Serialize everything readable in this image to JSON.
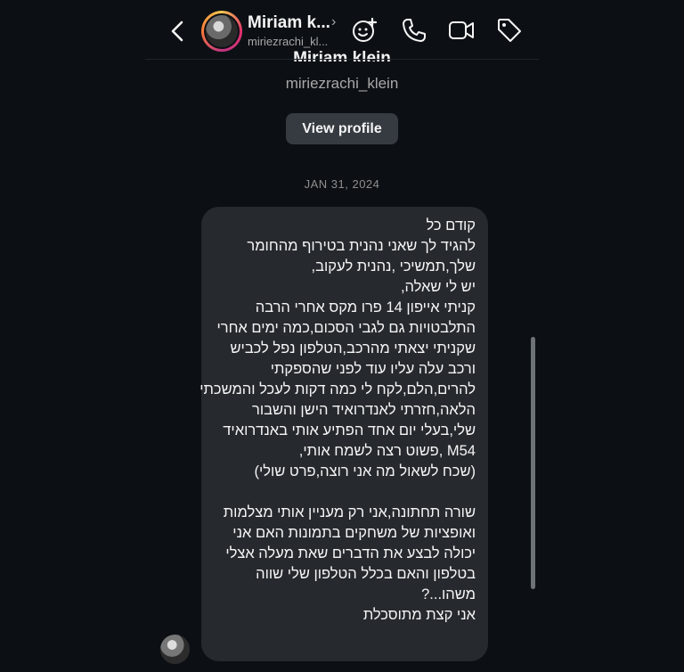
{
  "header": {
    "name": "Miriam k...",
    "handle": "miriezrachi_kl...",
    "icons": [
      "back-chevron-icon",
      "avatar",
      "effects-icon",
      "phone-icon",
      "video-call-icon",
      "tag-icon"
    ]
  },
  "profile": {
    "name": "Miriam klein",
    "handle": "miriezrachi_klein",
    "view_profile_label": "View profile"
  },
  "conversation": {
    "date_label": "JAN 31, 2024",
    "message": "קודם כל\nלהגיד לך שאני נהנית בטירוף מהחומר שלך,תמשיכי ,נהנית לעקוב,\nיש לי שאלה,\nקניתי אייפון 14 פרו מקס אחרי הרבה התלבטויות גם לגבי הסכום,כמה ימים אחרי שקניתי יצאתי מהרכב,הטלפון נפל לכביש ורכב עלה עליו עוד לפני שהספקתי להרים,הלם,לקח לי כמה דקות לעכל והמשכתי הלאה,חזרתי לאנדרואיד הישן והשבור שלי,בעלי יום אחד הפתיע אותי באנדרואיד M54 ,פשוט רצה לשמח אותי,\n(שכח לשאול מה אני רוצה,פרט שולי)\n\nשורה תחתונה,אני רק מעניין אותי מצלמות ואופציות של משחקים בתמונות האם אני יכולה לבצע את הדברים שאת מעלה אצלי בטלפון והאם בכלל הטלפון שלי שווה משהו...?\nאני קצת מתוסכלת"
  },
  "colors": {
    "background": "#0c1014",
    "bubble": "#262a2f",
    "button": "#363b41",
    "secondary_text": "#a8a8a8"
  }
}
